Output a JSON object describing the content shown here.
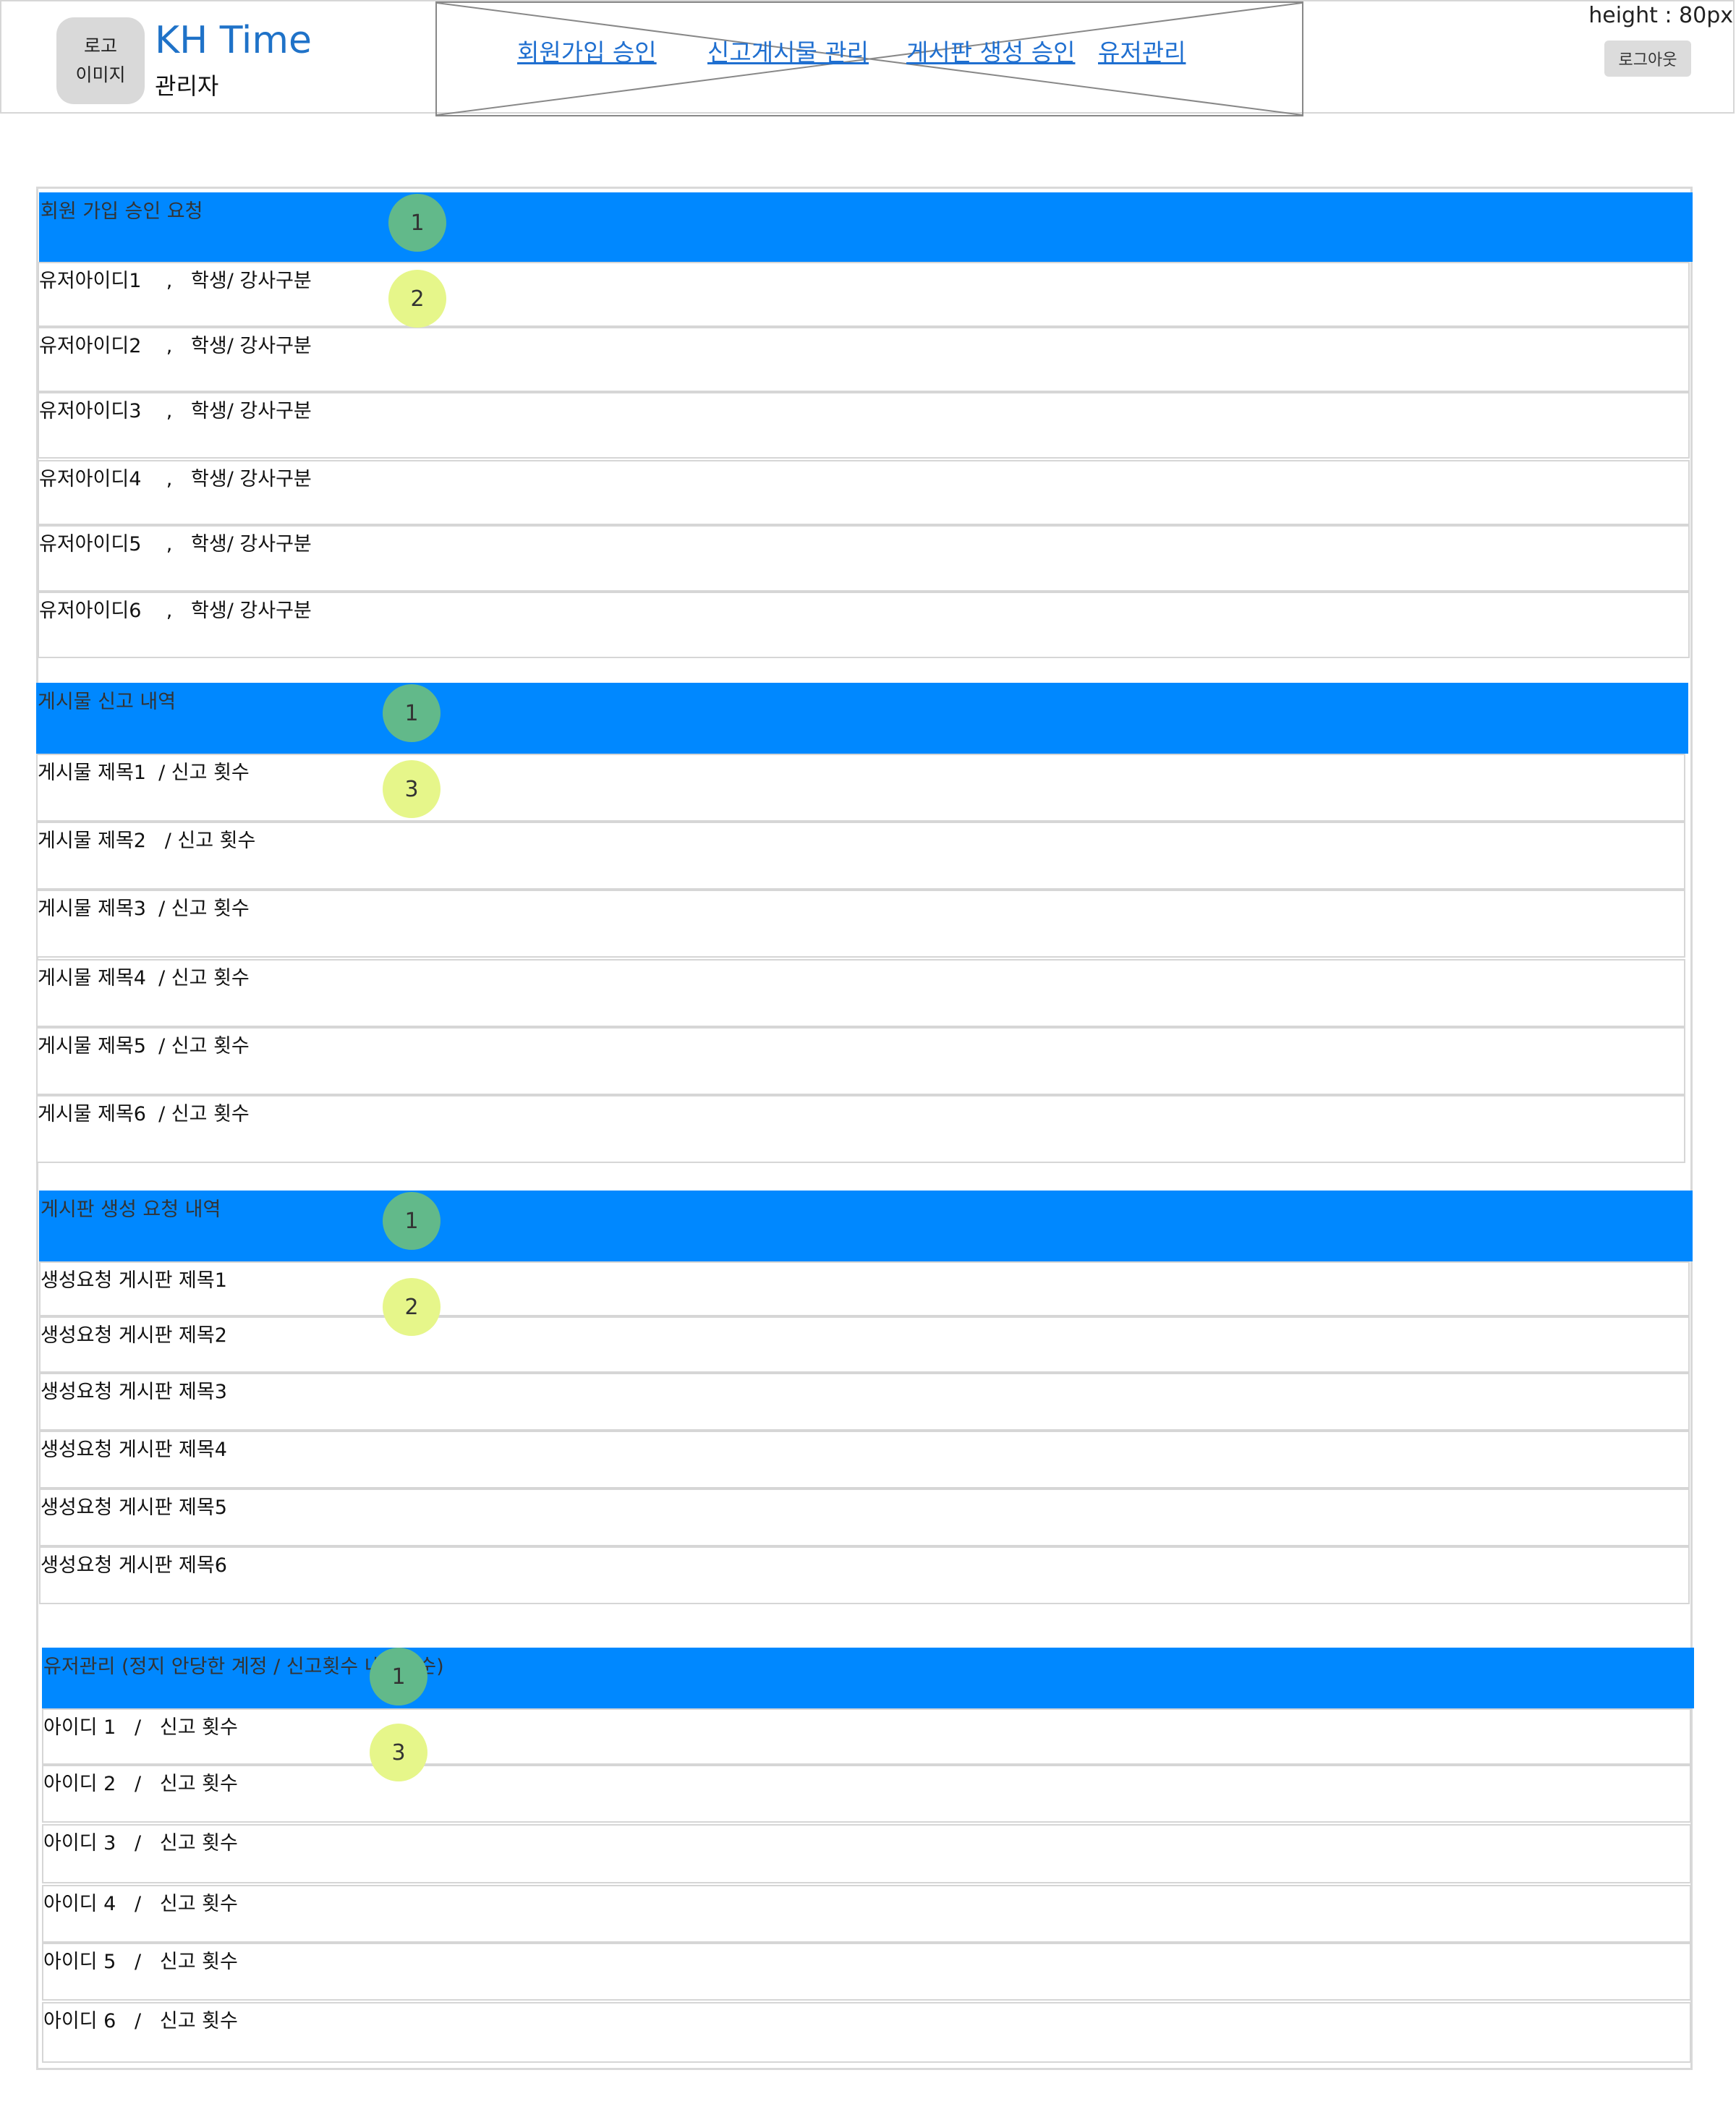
{
  "header": {
    "logo_line1": "로고",
    "logo_line2": "이미지",
    "title": "KH Time",
    "subtitle": "관리자",
    "nav": [
      "회원가입 승인",
      "신고게시물 관리",
      "게시판 생성 승인",
      "유저관리"
    ],
    "height_note": "height : 80px",
    "logout": "로그아웃"
  },
  "sections": {
    "signup": {
      "title": "회원 가입 승인 요청",
      "badges": [
        "1",
        "2"
      ],
      "rows": [
        "유저아이디1    ,   학생/ 강사구분",
        "유저아이디2    ,   학생/ 강사구분",
        "유저아이디3    ,   학생/ 강사구분",
        "유저아이디4    ,   학생/ 강사구분",
        "유저아이디5    ,   학생/ 강사구분",
        "유저아이디6    ,   학생/ 강사구분"
      ]
    },
    "reports": {
      "title": "게시물  신고 내역",
      "badges": [
        "1",
        "3"
      ],
      "rows": [
        "게시물 제목1  / 신고 횟수",
        "게시물 제목2   / 신고 횟수",
        "게시물 제목3  / 신고 횟수",
        "게시물 제목4  / 신고 횟수",
        "게시물 제목5  / 신고 횟수",
        "게시물 제목6  / 신고 횟수"
      ]
    },
    "boards": {
      "title": "게시판 생성 요청 내역",
      "badges": [
        "1",
        "2"
      ],
      "rows": [
        "생성요청 게시판 제목1",
        "생성요청 게시판 제목2",
        "생성요청 게시판 제목3",
        "생성요청 게시판 제목4",
        "생성요청 게시판 제목5",
        "생성요청 게시판 제목6"
      ]
    },
    "users": {
      "title": "유저관리 (정지 안당한 계정 / 신고횟수 내림차순)",
      "badges": [
        "1",
        "3"
      ],
      "rows": [
        "아이디 1   /   신고 횟수",
        "아이디 2   /   신고 횟수",
        "아이디 3   /   신고 횟수",
        "아이디 4   /   신고 횟수",
        "아이디 5   /   신고 횟수",
        "아이디 6   /   신고 횟수"
      ]
    }
  },
  "colors": {
    "section_header_bg": "#0088ff",
    "badge_green": "#62b98a",
    "badge_yellow": "#e6f68a",
    "link": "#1f6fd0",
    "brand": "#1f72c8"
  }
}
